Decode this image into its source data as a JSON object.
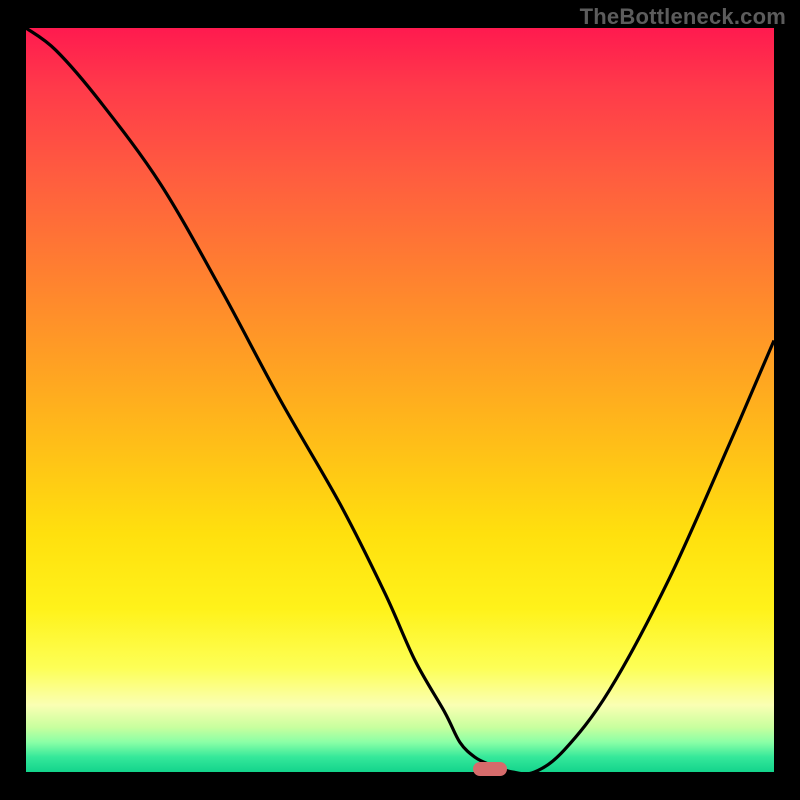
{
  "watermark": "TheBottleneck.com",
  "colors": {
    "background": "#000000",
    "curve": "#000000",
    "marker": "#d66b6b",
    "gradient_stops": [
      "#ff1a4f",
      "#ff3a4a",
      "#ff5d3f",
      "#ff8030",
      "#ffa322",
      "#ffc416",
      "#ffe00e",
      "#fff21a",
      "#fdff56",
      "#faffb3",
      "#c8ff9e",
      "#8affa6",
      "#35e89a",
      "#13d48c"
    ]
  },
  "chart_data": {
    "type": "line",
    "title": "",
    "xlabel": "",
    "ylabel": "",
    "xlim": [
      0,
      100
    ],
    "ylim": [
      0,
      100
    ],
    "x": [
      0,
      4,
      10,
      18,
      26,
      34,
      42,
      48,
      52,
      56,
      58,
      60,
      62,
      65,
      68,
      72,
      78,
      86,
      94,
      100
    ],
    "y": [
      100,
      97,
      90,
      79,
      65,
      50,
      36,
      24,
      15,
      8,
      4,
      2,
      1,
      0,
      0,
      3,
      11,
      26,
      44,
      58
    ],
    "marker": {
      "x": 62,
      "y": 0,
      "label": ""
    },
    "annotations": []
  }
}
